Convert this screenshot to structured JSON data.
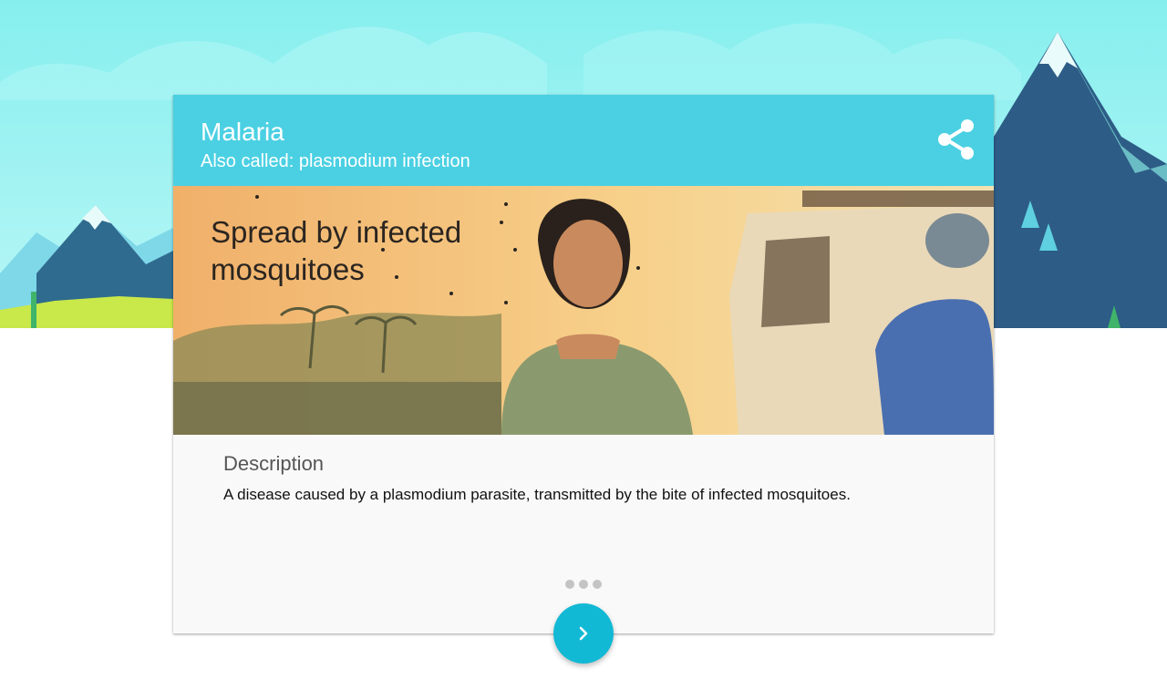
{
  "card": {
    "title": "Malaria",
    "subtitle": "Also called: plasmodium infection",
    "image_caption": "Spread by infected mosquitoes",
    "description_heading": "Description",
    "description_text": "A disease caused by a plasmodium parasite, transmitted by the bite of infected mosquitoes."
  },
  "pager": {
    "count": 3
  },
  "icons": {
    "share": "share-icon",
    "next": "chevron-right-icon"
  },
  "colors": {
    "header": "#4bd0e3",
    "next_button": "#12b9d4",
    "sky": "#8ff0f0",
    "mountain": "#2f5e86"
  }
}
